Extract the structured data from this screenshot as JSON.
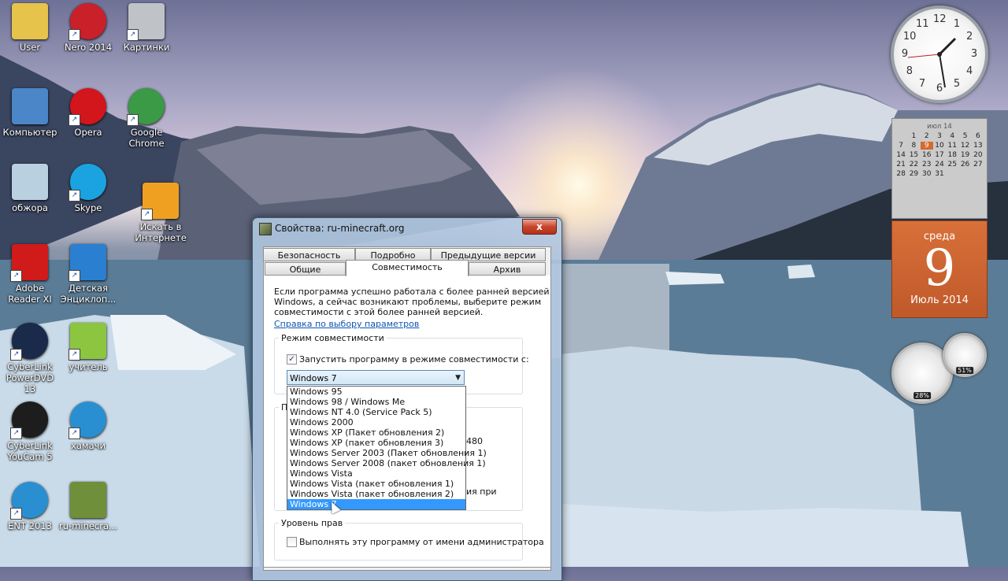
{
  "desktop": {
    "icons": [
      {
        "label": "User",
        "icon": "folder-user-icon",
        "shortcut": false
      },
      {
        "label": "Nero 2014",
        "icon": "nero-icon",
        "shortcut": true
      },
      {
        "label": "Картинки",
        "icon": "camera-icon",
        "shortcut": true
      },
      {
        "label": "Компьютер",
        "icon": "computer-icon",
        "shortcut": false
      },
      {
        "label": "Opera",
        "icon": "opera-icon",
        "shortcut": true
      },
      {
        "label": "Google Chrome",
        "icon": "chrome-icon",
        "shortcut": true
      },
      {
        "label": "обжора",
        "icon": "recycle-bin-icon",
        "shortcut": false
      },
      {
        "label": "Skype",
        "icon": "skype-icon",
        "shortcut": true
      },
      {
        "label": "Искать в Интернете",
        "icon": "web-search-icon",
        "shortcut": true
      },
      {
        "label": "Adobe Reader XI",
        "icon": "adobe-reader-icon",
        "shortcut": true
      },
      {
        "label": "Детская Энциклоп...",
        "icon": "encyclopedia-icon",
        "shortcut": true
      },
      {
        "label": "CyberLink PowerDVD 13",
        "icon": "powerdvd-icon",
        "shortcut": true
      },
      {
        "label": "учитель",
        "icon": "solo-icon",
        "shortcut": true
      },
      {
        "label": "CyberLink YouCam 5",
        "icon": "youcam-icon",
        "shortcut": true
      },
      {
        "label": "хамачи",
        "icon": "hamachi-icon",
        "shortcut": true
      },
      {
        "label": "ENT 2013",
        "icon": "ent-icon",
        "shortcut": true
      },
      {
        "label": "ru-minecra...",
        "icon": "minecraft-icon",
        "shortcut": false
      }
    ]
  },
  "gadgets": {
    "clock": {
      "numbers": [
        "12",
        "1",
        "2",
        "3",
        "4",
        "5",
        "6",
        "7",
        "8",
        "9",
        "10",
        "11"
      ]
    },
    "calendar": {
      "header": "июл 14",
      "days": [
        "",
        "1",
        "2",
        "3",
        "4",
        "5",
        "6",
        "7",
        "8",
        "9",
        "10",
        "11",
        "12",
        "13",
        "14",
        "15",
        "16",
        "17",
        "18",
        "19",
        "20",
        "21",
        "22",
        "23",
        "24",
        "25",
        "26",
        "27",
        "28",
        "29",
        "30",
        "31",
        "",
        "",
        ""
      ],
      "today": "9"
    },
    "date": {
      "weekday": "среда",
      "day": "9",
      "month": "Июль 2014"
    },
    "cpu_meter": {
      "value": "28%",
      "fill": 0.28
    },
    "memory_meter": {
      "value": "51%",
      "fill": 0.51
    }
  },
  "window": {
    "title": "Свойства: ru-minecraft.org",
    "close_label": "x",
    "tabs_row1": [
      "Безопасность",
      "Подробно",
      "Предыдущие версии"
    ],
    "tabs_row2": [
      "Общие",
      "Совместимость",
      "Архив"
    ],
    "active_tab": "Совместимость",
    "intro": [
      "Если программа успешно работала с более ранней версией",
      "Windows, а сейчас возникают проблемы, выберите режим",
      "совместимости с этой более ранней версией."
    ],
    "help_link": "Справка по выбору параметров",
    "compat_group": {
      "label": "Режим совместимости",
      "checkbox_label": "Запустить программу в режиме совместимости с:",
      "checked": true,
      "selected": "Windows 7",
      "options": [
        "Windows 95",
        "Windows 98 / Windows Me",
        "Windows NT 4.0 (Service Pack 5)",
        "Windows 2000",
        "Windows XP (Пакет обновления 2)",
        "Windows XP (пакет обновления 3)",
        "Windows Server 2003 (Пакет обновления 1)",
        "Windows Server 2008 (пакет обновления 1)",
        "Windows Vista",
        "Windows Vista (пакет обновления 1)",
        "Windows Vista (пакет обновления 2)",
        "Windows 7"
      ]
    },
    "params_group": {
      "label_partial": "П",
      "text1_partial": "480",
      "text2_partial": "ия при"
    },
    "rights_group": {
      "label": "Уровень прав",
      "checkbox_label": "Выполнять эту программу от имени администратора",
      "checked": false
    }
  }
}
